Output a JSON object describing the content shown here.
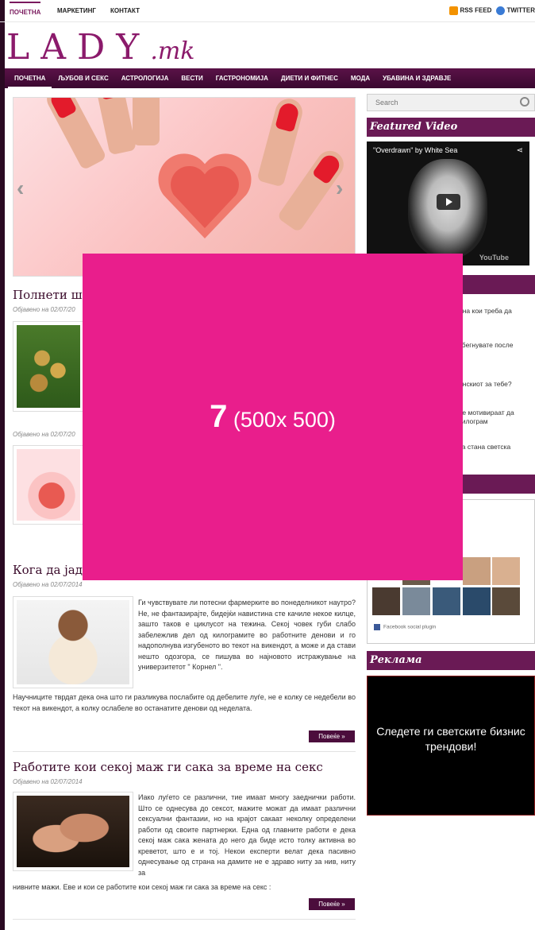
{
  "topbar": {
    "links": [
      "ПОЧЕТНА",
      "МАРКЕТИНГ",
      "КОНТАКТ"
    ],
    "rss": "RSS FEED",
    "twitter": "TWITTER"
  },
  "logo": {
    "main": "LADY",
    "suffix": ".mk"
  },
  "nav": [
    "ПОЧЕТНА",
    "ЉУБОВ И СЕКС",
    "АСТРОЛОГИЈА",
    "ВЕСТИ",
    "ГАСТРОНОМИЈА",
    "ДИЕТИ И ФИТНЕС",
    "МОДА",
    "УБАВИНА И ЗДРАВЈЕ"
  ],
  "posts": [
    {
      "title": "Полнети ш",
      "meta": "Објавено на 02/07/20"
    },
    {
      "meta": "Објавено на 02/07/20"
    },
    {
      "title": "Кога да јад",
      "meta": "Објавено на 02/07/2014",
      "excerpt_side": "Ги чувствувате ли потесни фармерките во понеделникот наутро? Не, не фантазирајте, бидејќи навистина сте качиле некое килце, зашто таков е циклусот на тежина. Секој човек губи слабо забележлив дел од килограмите во работните денови и го надополнува изгубеното во текот на викендот, а може и да стави нешто одозгора, се пишува во најновото истражување на универзитетот \" Корнел \".",
      "excerpt_full": "Научниците тврдат дека она што ги разликува послабите од дебелите луѓе, не е колку се недебели во текот на викендот, а колку ослабеле во останатите денови од неделата.",
      "more": "Повеќе »"
    },
    {
      "title": "Работите кои секој маж ги сака за време на секс",
      "meta": "Објавено на 02/07/2014",
      "excerpt_side": "Иако луѓето се различни, тие имаат многу заеднички работи. Што се однесува до сексот, мажите можат да имаат различни сексуални фантазии, но на крајот сакаат неколку определени работи од своите партнерки. Една од главните работи е дека секој маж сака жената до него да биде исто толку активна во креветот, што е и тој. Некои експерти велат дека пасивно однесување од страна на дамите не е здраво ниту за нив, ниту за",
      "excerpt_full": "нивните мажи. Еве и кои се работите кои секој маж ги сака за време на секс :",
      "more": "Повеќе »"
    }
  ],
  "sidebar": {
    "search_placeholder": "Search",
    "featured_video": "Featured Video",
    "video_title": "\"Overdrawn\" by White Sea",
    "video_brand": "YouTube",
    "list": [
      ", на кои треба да",
      "збегнувате после",
      "инскиот за тебе?",
      "ве мотивираат да килограм",
      "та стана светска"
    ],
    "fb_plugin": "Facebook social plugin",
    "ad_title": "Реклама",
    "ad_text": "Следете ги светските бизнис трендови!"
  },
  "overlay": {
    "num": "7",
    "size": "(500x 500)"
  }
}
